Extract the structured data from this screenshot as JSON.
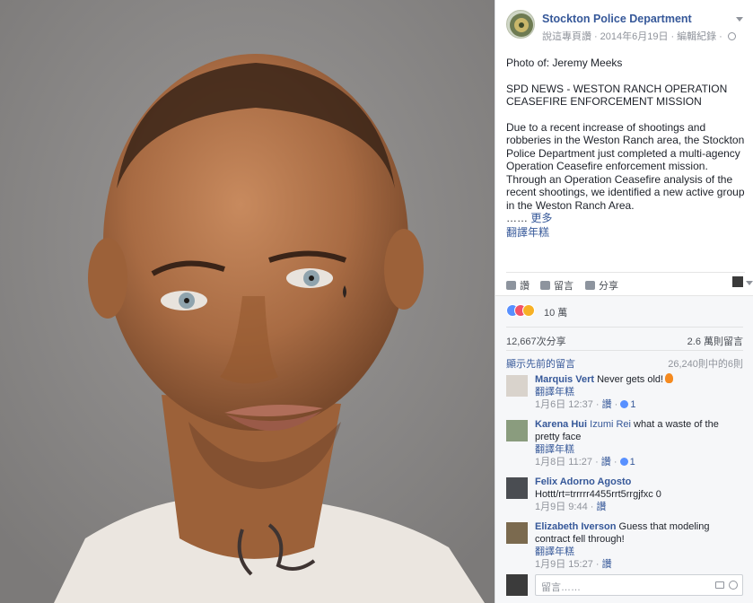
{
  "page": {
    "name": "Stockton Police Department",
    "like_page": "說這專頁讚",
    "date": "2014年6月19日",
    "edit_history": "編輯紀錄"
  },
  "post": {
    "photo_of": "Photo of: Jeremy Meeks",
    "headline": "SPD NEWS - WESTON RANCH OPERATION CEASEFIRE ENFORCEMENT MISSION",
    "body": "Due to a recent increase of shootings and robberies in the Weston Ranch area, the Stockton Police Department just completed a multi-agency Operation Ceasefire enforcement mission. Through an Operation Ceasefire analysis of the recent shootings, we identified a new active group in the Weston Ranch Area.",
    "ellipsis": "……",
    "more": "更多",
    "translate": "翻譯年糕"
  },
  "actions": {
    "like": "讚",
    "comment": "留言",
    "share": "分享"
  },
  "stats": {
    "reactions": "10 萬",
    "shares": "12,667次分享",
    "comments": "2.6 萬則留言",
    "show_previous": "顯示先前的留言",
    "comment_range": "26,240則中的6則"
  },
  "comments": [
    {
      "name": "Marquis Vert",
      "text": "Never gets old!",
      "translate": "翻譯年糕",
      "time": "1月6日 12:37",
      "like": "讚",
      "likes": "1"
    },
    {
      "name": "Karena Hui",
      "tag": "Izumi Rei",
      "text": "what a waste of the pretty face",
      "translate": "翻譯年糕",
      "time": "1月8日 11:27",
      "like": "讚",
      "likes": "1"
    },
    {
      "name": "Felix Adorno Agosto",
      "text": "Hottt/rt=trrrrr4455rrt5rrgjfxc 0",
      "time": "1月9日 9:44",
      "like": "讚"
    },
    {
      "name": "Elizabeth Iverson",
      "text": "Guess that modeling contract fell through!",
      "translate": "翻譯年糕",
      "time": "1月9日 15:27",
      "like": "讚"
    }
  ],
  "composer": {
    "placeholder": "留言……"
  },
  "colors": {
    "link": "#365899",
    "meta": "#90949c",
    "panel_grey": "#f6f7f9"
  },
  "icons": [
    "globe-icon",
    "chevron-down-icon",
    "like-icon",
    "comment-icon",
    "share-icon",
    "camera-icon",
    "emoji-icon",
    "fire-emoji-icon"
  ]
}
